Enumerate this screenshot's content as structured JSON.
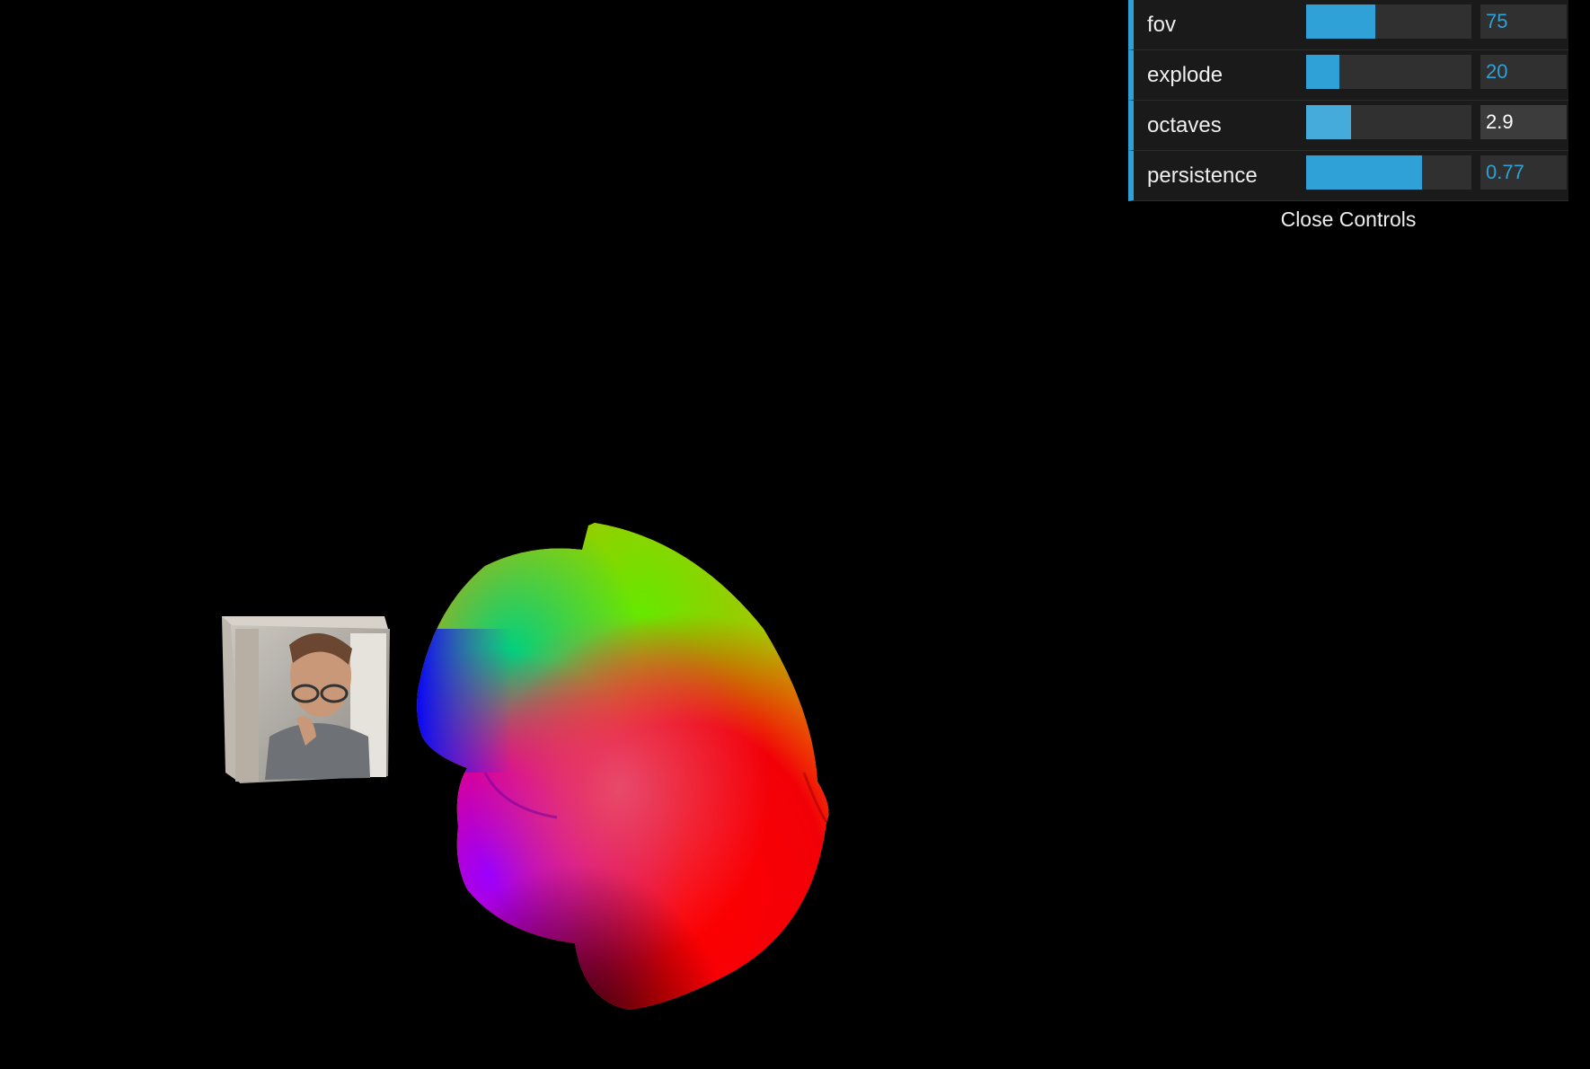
{
  "controls": {
    "rows": [
      {
        "label": "fov",
        "value": "75",
        "fill": 0.42
      },
      {
        "label": "explode",
        "value": "20",
        "fill": 0.2
      },
      {
        "label": "octaves",
        "value": "2.9",
        "fill": 0.27
      },
      {
        "label": "persistence",
        "value": "0.77",
        "fill": 0.7
      }
    ],
    "close_label": "Close Controls"
  },
  "colors": {
    "background": "#000000",
    "accent": "#2fa1d6",
    "panel": "#1a1a1a"
  }
}
